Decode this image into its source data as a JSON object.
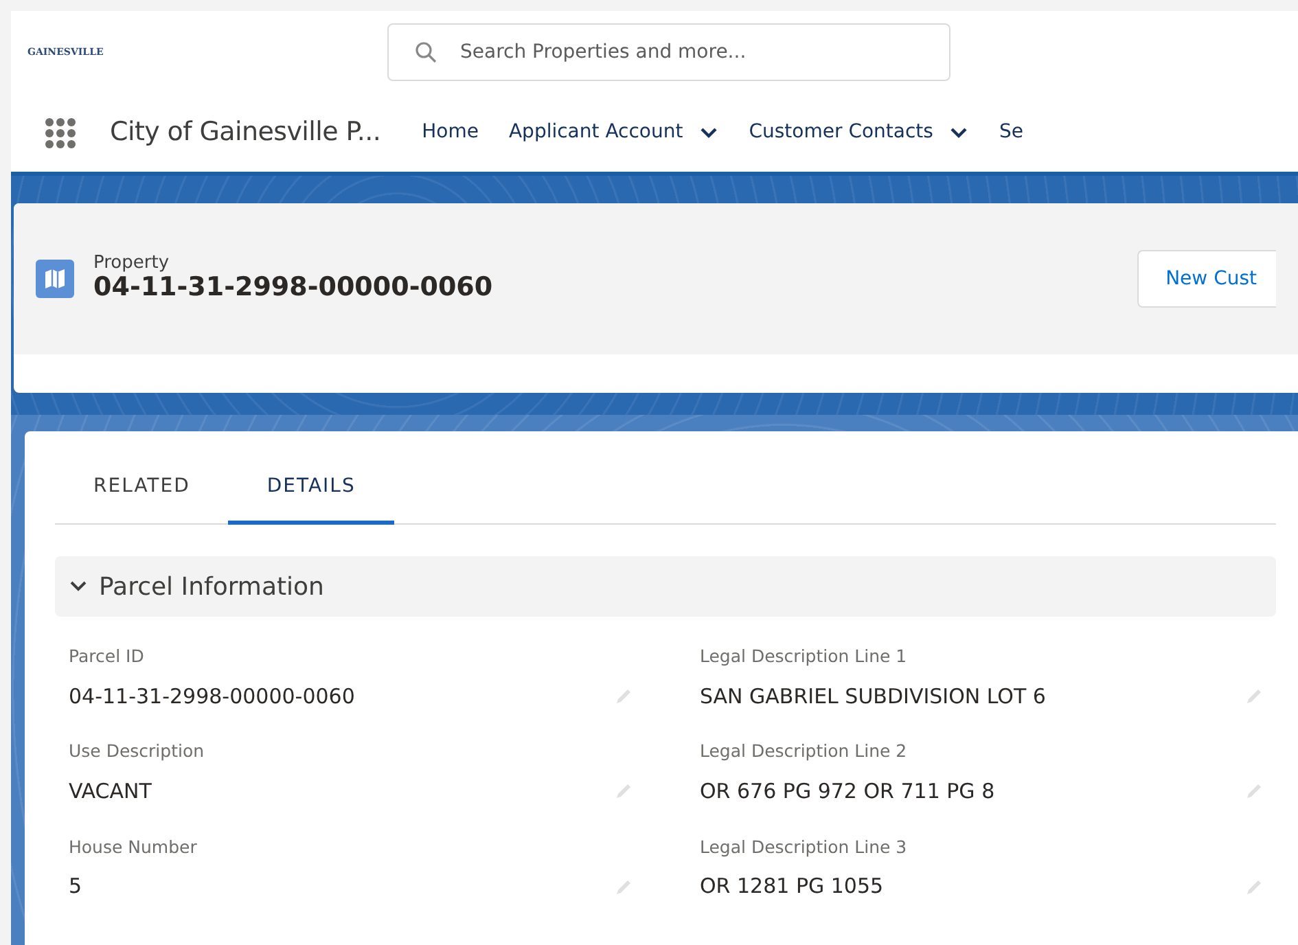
{
  "header": {
    "logo": "GAINESVILLE",
    "search": {
      "placeholder": "Search Properties and more..."
    }
  },
  "nav": {
    "app_name": "City of Gainesville P...",
    "items": [
      {
        "label": "Home",
        "dropdown": false
      },
      {
        "label": "Applicant Account",
        "dropdown": true
      },
      {
        "label": "Customer Contacts",
        "dropdown": true
      },
      {
        "label": "Se",
        "dropdown": false
      }
    ]
  },
  "record": {
    "object": "Property",
    "title": "04-11-31-2998-00000-0060",
    "button": "New Cust"
  },
  "tabs": [
    {
      "label": "RELATED",
      "selected": false
    },
    {
      "label": "DETAILS",
      "selected": true
    }
  ],
  "section": {
    "title": "Parcel Information",
    "expanded": true,
    "fields": [
      {
        "label": "Parcel ID",
        "value": "04-11-31-2998-00000-0060"
      },
      {
        "label": "Legal Description Line 1",
        "value": "SAN GABRIEL SUBDIVISION LOT 6"
      },
      {
        "label": "Use Description",
        "value": "VACANT"
      },
      {
        "label": "Legal Description Line 2",
        "value": "OR 676 PG 972 OR 711 PG 8"
      },
      {
        "label": "House Number",
        "value": "5"
      },
      {
        "label": "Legal Description Line 3",
        "value": "OR 1281 PG 1055"
      }
    ]
  }
}
